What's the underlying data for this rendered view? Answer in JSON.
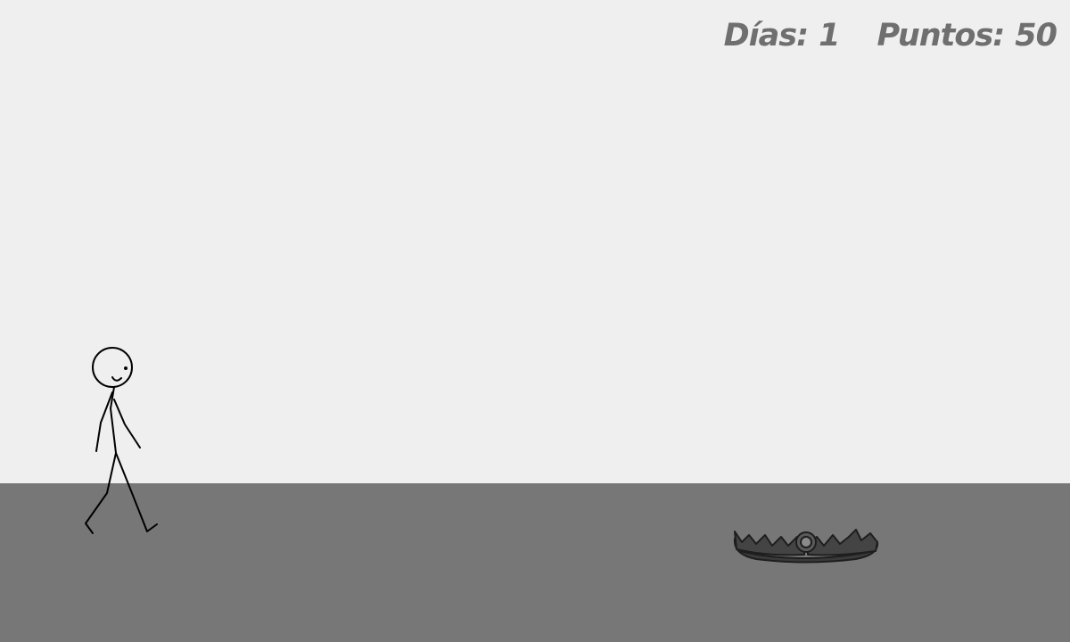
{
  "colors": {
    "sky": "#efefef",
    "ground": "#777777",
    "hud_text": "#6f6f6f",
    "stick_figure": "#000000",
    "trap": "#2f2f2f"
  },
  "hud": {
    "days_label": "Días:",
    "days_value": "1",
    "points_label": "Puntos:",
    "points_value": "50"
  },
  "entities": {
    "player": {
      "icon": "stick-figure-icon"
    },
    "obstacle": {
      "icon": "bear-trap-icon"
    }
  }
}
